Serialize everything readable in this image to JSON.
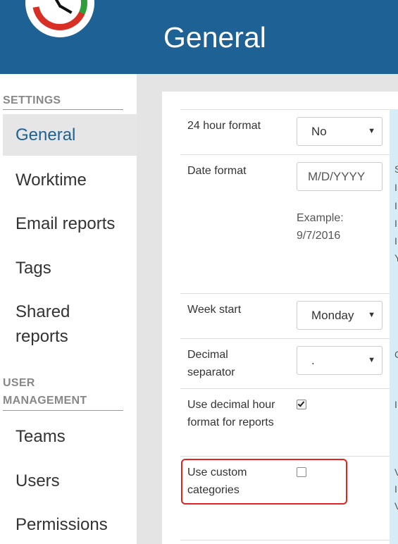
{
  "header": {
    "title": "General"
  },
  "sidebar": {
    "settings_label": "SETTINGS",
    "user_management_label": "USER MANAGEMENT",
    "settings_items": [
      {
        "label": "General",
        "active": true
      },
      {
        "label": "Worktime"
      },
      {
        "label": "Email reports"
      },
      {
        "label": "Tags"
      },
      {
        "label": "Shared reports"
      }
    ],
    "user_items": [
      {
        "label": "Teams"
      },
      {
        "label": "Users"
      },
      {
        "label": "Permissions"
      }
    ]
  },
  "settings": {
    "hour_format": {
      "label": "24 hour format",
      "value": "No"
    },
    "date_format": {
      "label": "Date format",
      "value": "M/D/YYYY",
      "example_label": "Example:",
      "example_value": "9/7/2016"
    },
    "week_start": {
      "label": "Week start",
      "value": "Monday"
    },
    "decimal_separator": {
      "label": "Decimal separator",
      "value": "."
    },
    "decimal_hours": {
      "label": "Use decimal hour format for reports",
      "checked": true
    },
    "custom_categories": {
      "label": "Use custom categories",
      "checked": false
    }
  },
  "colors": {
    "header": "#1e6295",
    "highlight": "#e02424",
    "help_strip": "#d6ecf6"
  }
}
